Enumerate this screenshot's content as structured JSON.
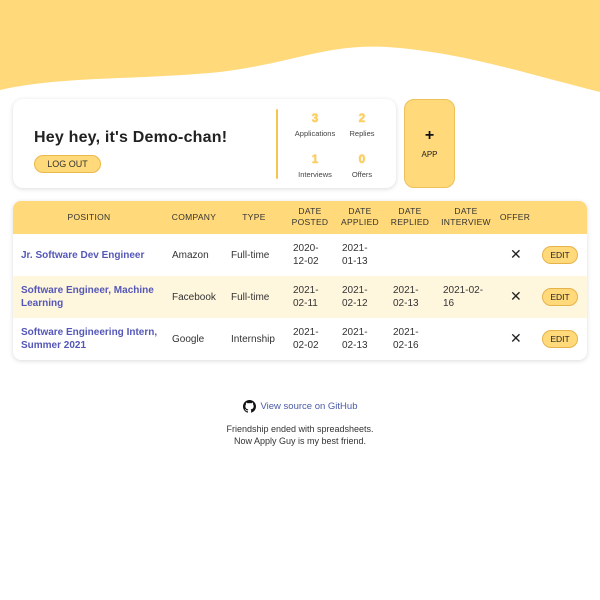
{
  "colors": {
    "accent": "#ffd97a",
    "accent_border": "#e6b34a",
    "link": "#5457b8",
    "alt_row": "#fff6de"
  },
  "profile": {
    "greeting": "Hey hey, it's Demo-chan!",
    "logout_label": "LOG OUT",
    "stats": [
      {
        "value": "3",
        "label": "Applications"
      },
      {
        "value": "2",
        "label": "Replies"
      },
      {
        "value": "1",
        "label": "Interviews"
      },
      {
        "value": "0",
        "label": "Offers"
      }
    ]
  },
  "add_app": {
    "icon": "plus-icon",
    "plus": "+",
    "label": "APP"
  },
  "table": {
    "headers": {
      "position": "POSITION",
      "company": "COMPANY",
      "type": "TYPE",
      "date_posted_1": "DATE",
      "date_posted_2": "POSTED",
      "date_applied_1": "DATE",
      "date_applied_2": "APPLIED",
      "date_replied_1": "DATE",
      "date_replied_2": "REPLIED",
      "date_interview_1": "DATE",
      "date_interview_2": "INTERVIEW",
      "offer": "OFFER"
    },
    "rows": [
      {
        "position_1": "Jr. Software Dev Engineer",
        "position_2": "",
        "company": "Amazon",
        "type": "Full-time",
        "posted_1": "2020-",
        "posted_2": "12-02",
        "applied_1": "2021-",
        "applied_2": "01-13",
        "replied_1": "",
        "replied_2": "",
        "interview_1": "",
        "interview_2": "",
        "offer": "✕",
        "edit": "EDIT"
      },
      {
        "position_1": "Software Engineer, Machine",
        "position_2": "Learning",
        "company": "Facebook",
        "type": "Full-time",
        "posted_1": "2021-",
        "posted_2": "02-11",
        "applied_1": "2021-",
        "applied_2": "02-12",
        "replied_1": "2021-",
        "replied_2": "02-13",
        "interview_1": "2021-02-",
        "interview_2": "16",
        "offer": "✕",
        "edit": "EDIT"
      },
      {
        "position_1": "Software Engineering Intern,",
        "position_2": "Summer 2021",
        "company": "Google",
        "type": "Internship",
        "posted_1": "2021-",
        "posted_2": "02-02",
        "applied_1": "2021-",
        "applied_2": "02-13",
        "replied_1": "2021-",
        "replied_2": "02-16",
        "interview_1": "",
        "interview_2": "",
        "offer": "✕",
        "edit": "EDIT"
      }
    ]
  },
  "footer": {
    "github_icon": "github-icon",
    "link_text": "View source on GitHub",
    "line1": "Friendship ended with spreadsheets.",
    "line2": "Now Apply Guy is my best friend."
  }
}
